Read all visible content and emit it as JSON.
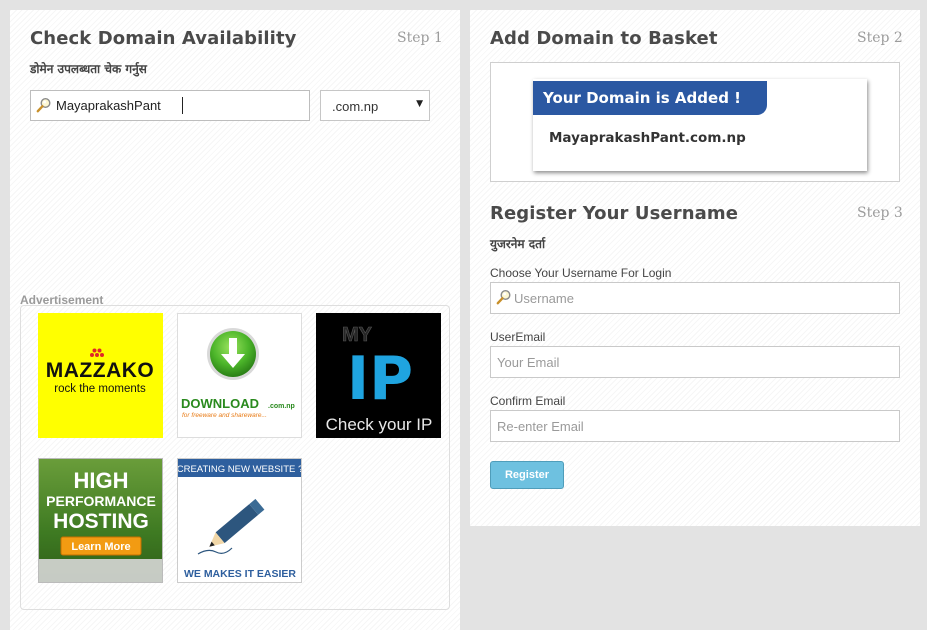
{
  "step1": {
    "title": "Check Domain Availability",
    "step_label": "Step 1",
    "subtitle": "डोमेन उपलब्धता चेक गर्नुस",
    "search_value": "MayaprakashPant",
    "tld_selected": ".com.np"
  },
  "ads": {
    "legend": "Advertisement",
    "items": [
      {
        "name": "mazzako",
        "line1": "MAZZAKO",
        "line2": "rock the moments"
      },
      {
        "name": "download",
        "line1": "DOWNLOAD",
        "line1b": ".com.np",
        "line2": "for freeware and shareware..."
      },
      {
        "name": "myip",
        "line1": "MY",
        "line2": "IP",
        "line3": "Check your IP"
      },
      {
        "name": "hosting",
        "line1": "HIGH",
        "line2": "PERFORMANCE",
        "line3": "HOSTING",
        "button": "Learn More"
      },
      {
        "name": "newwebsite",
        "line1": "CREATING NEW WEBSITE ?",
        "line2": "WE MAKES IT EASIER"
      }
    ]
  },
  "step2": {
    "title": "Add Domain to Basket",
    "step_label": "Step 2",
    "banner": "Your Domain is Added !",
    "domain": "MayaprakashPant.com.np"
  },
  "step3": {
    "title": "Register Your Username",
    "step_label": "Step 3",
    "subtitle": "युजरनेम दर्ता",
    "username_label": "Choose Your Username For Login",
    "username_placeholder": "Username",
    "email_label": "UserEmail",
    "email_placeholder": "Your Email",
    "confirm_label": "Confirm Email",
    "confirm_placeholder": "Re-enter Email",
    "register_button": "Register"
  },
  "colors": {
    "banner_blue": "#2b58a2",
    "button_blue": "#6ec1e0",
    "mazzako_yellow": "#ffff00"
  }
}
